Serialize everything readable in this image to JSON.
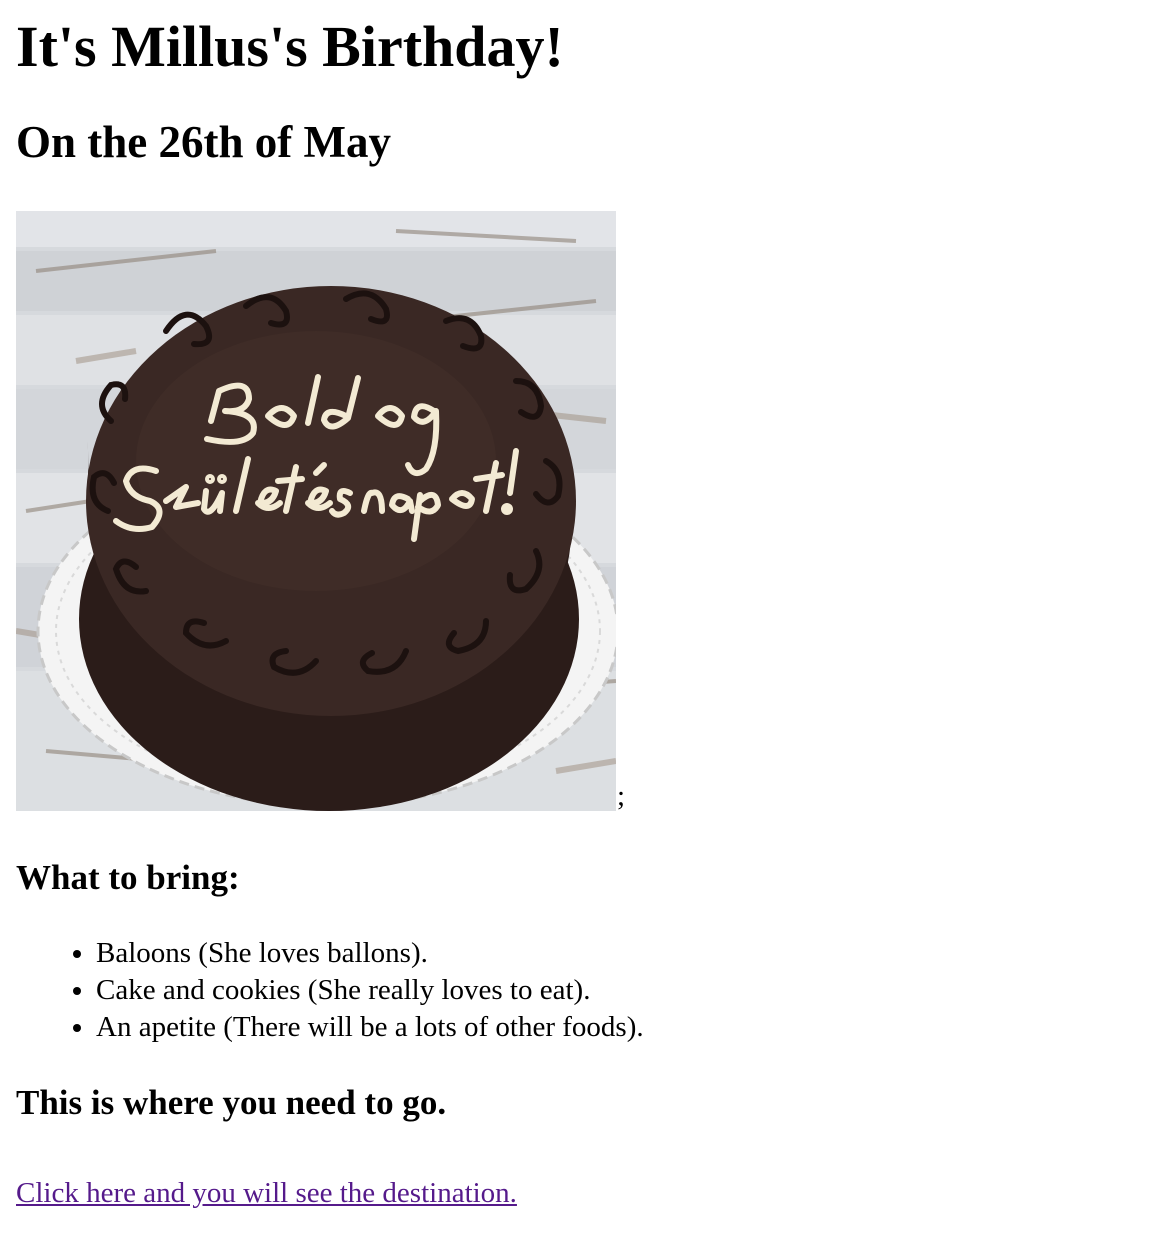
{
  "page": {
    "title": "It's Millus's Birthday!",
    "subtitle": "On the 26th of May",
    "image": {
      "cake_inscription_line1": "Boldog",
      "cake_inscription_line2": "Születésnapot!",
      "trailing_text": ";"
    },
    "bring": {
      "heading": "What to bring:",
      "items": [
        "Baloons (She loves ballons).",
        "Cake and cookies (She really loves to eat).",
        "An apetite (There will be a lots of other foods)."
      ]
    },
    "where": {
      "heading": "This is where you need to go.",
      "link_text": "Click here and you will see the destination."
    }
  },
  "colors": {
    "link_visited": "#551a8b",
    "chocolate": "#3a2824",
    "icing": "#f3ead3"
  }
}
